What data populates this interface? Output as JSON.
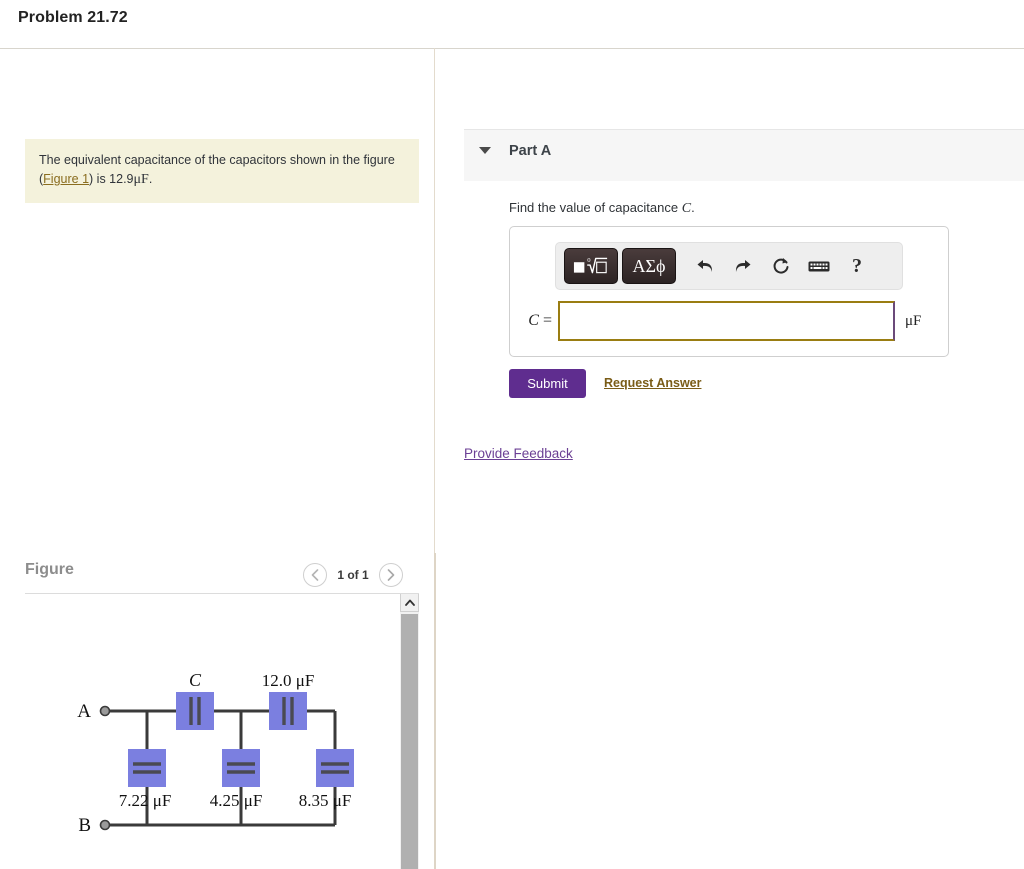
{
  "header": {
    "problem_title": "Problem 21.72"
  },
  "statement": {
    "text_before_link": "The equivalent capacitance of the capacitors shown in the figure (",
    "link_label": "Figure 1",
    "text_after_link": ") is ",
    "value": "12.9",
    "unit": "μF",
    "period": "."
  },
  "figure_panel": {
    "heading": "Figure",
    "prev_icon": "chevron-left-icon",
    "next_icon": "chevron-right-icon",
    "counter": "1 of 1",
    "scroll_up_icon": "chevron-up-icon"
  },
  "circuit": {
    "terminal_a": "A",
    "terminal_b": "B",
    "labels": {
      "top_left_cap": "C",
      "top_right_cap": "12.0 μF",
      "branch_1": "7.22 μF",
      "branch_2": "4.25 μF",
      "branch_3": "8.35 μF"
    },
    "colors": {
      "highlight": "#7b7fe0",
      "wire": "#3a3a3a",
      "plate": "#4a4a52"
    }
  },
  "part_a": {
    "toggle_icon": "caret-down-icon",
    "label": "Part A",
    "prompt_before": "Find the value of capacitance ",
    "prompt_var": "C",
    "prompt_after": ".",
    "toolbar": {
      "template_button": {
        "icon": "math-template-icon",
        "label": "√"
      },
      "greek_button": {
        "icon": "greek-symbols-icon",
        "label": "ΑΣϕ"
      },
      "undo_icon": "undo-icon",
      "redo_icon": "redo-icon",
      "reset_icon": "reset-icon",
      "keyboard_icon": "keyboard-icon",
      "help_icon": "help-icon",
      "help_label": "?"
    },
    "answer": {
      "variable": "C",
      "equals": "=",
      "value": "",
      "placeholder": "",
      "unit": "μF"
    },
    "submit_label": "Submit",
    "request_answer_label": "Request Answer"
  },
  "footer": {
    "provide_feedback_label": "Provide Feedback"
  },
  "colors": {
    "submit_purple": "#5f2d8f",
    "link_gold": "#8a6d1f",
    "link_purple": "#6b3f94",
    "statement_bg": "#f4f2dc",
    "input_border": "#9a7d12"
  }
}
